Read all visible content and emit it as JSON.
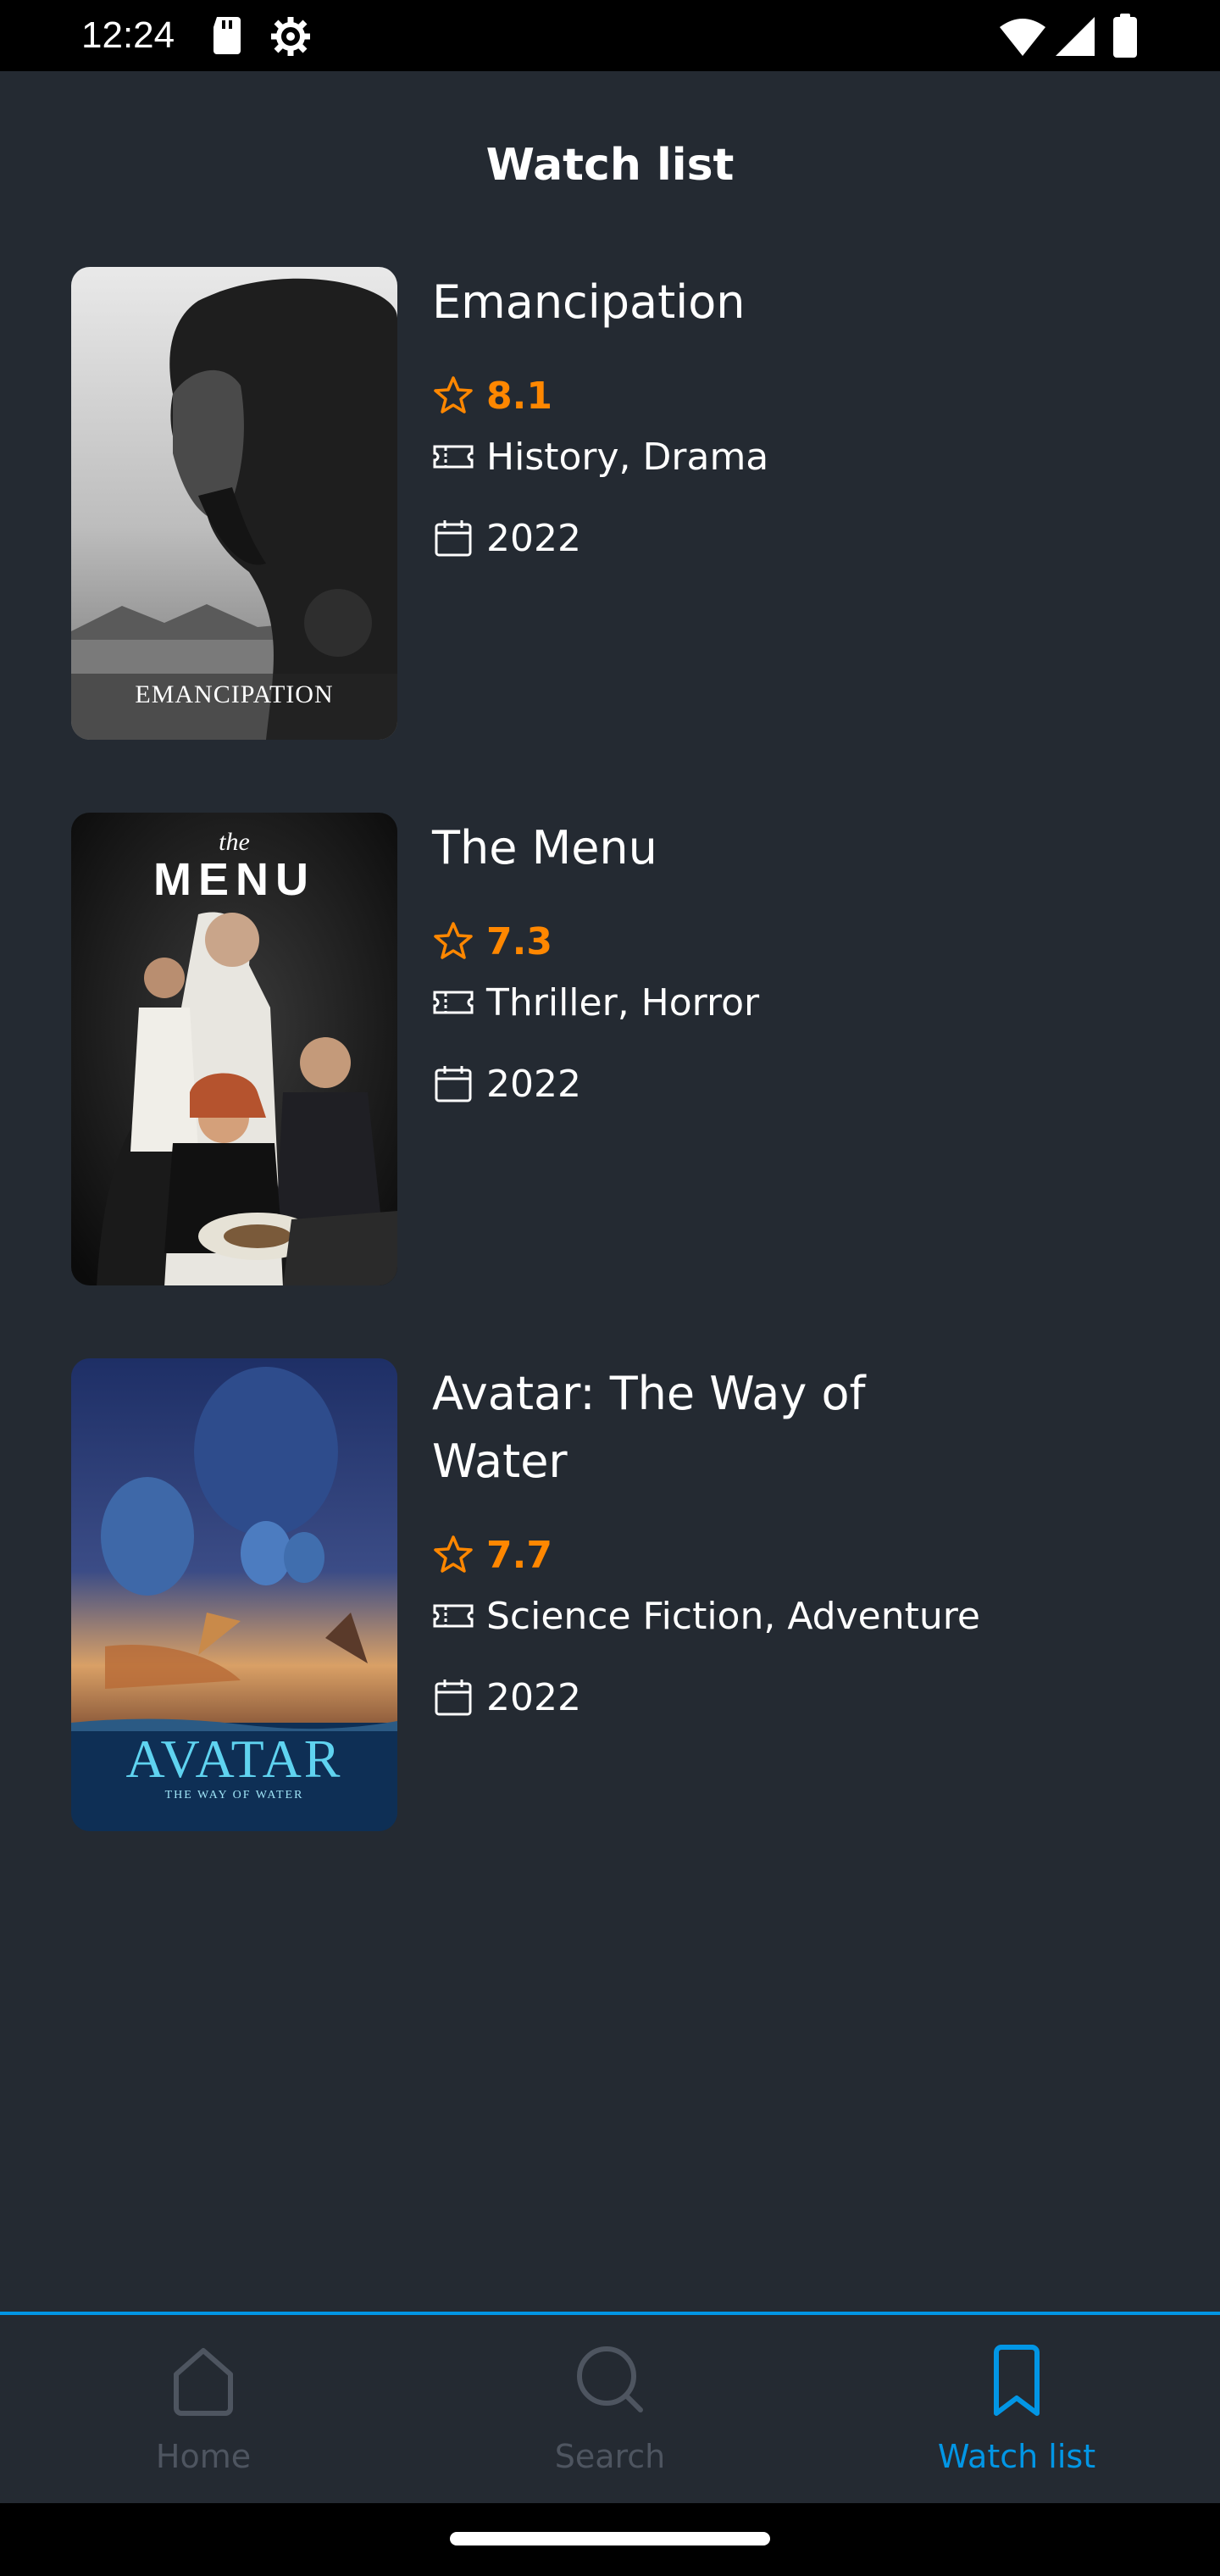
{
  "status_bar": {
    "time": "12:24",
    "left_icons": [
      "sd-card-icon",
      "settings-gear-icon"
    ],
    "right_icons": [
      "wifi-icon",
      "cellular-signal-icon",
      "battery-icon"
    ]
  },
  "header": {
    "title": "Watch list"
  },
  "colors": {
    "background": "#242A32",
    "accent": "#0296E5",
    "rating": "#FF8700",
    "inactive": "#4E5560"
  },
  "movies": [
    {
      "title": "Emancipation",
      "rating": "8.1",
      "genres": "History, Drama",
      "year": "2022",
      "poster_text": "EMANCIPATION"
    },
    {
      "title": "The Menu",
      "rating": "7.3",
      "genres": "Thriller, Horror",
      "year": "2022",
      "poster_text_top": "the",
      "poster_text_main": "MENU"
    },
    {
      "title": "Avatar: The Way of Water",
      "rating": "7.7",
      "genres": "Science Fiction, Adventure",
      "year": "2022",
      "poster_text_main": "AVATAR",
      "poster_text_sub": "THE WAY OF WATER"
    }
  ],
  "bottom_nav": {
    "items": [
      {
        "label": "Home",
        "icon": "home-icon",
        "active": false
      },
      {
        "label": "Search",
        "icon": "search-icon",
        "active": false
      },
      {
        "label": "Watch list",
        "icon": "bookmark-icon",
        "active": true
      }
    ]
  }
}
